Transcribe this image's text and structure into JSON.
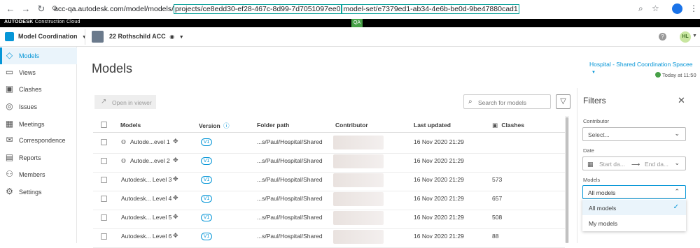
{
  "browser": {
    "url_base": "acc-qa.autodesk.com/model/models/",
    "url_project": "projects/ce8edd30-ef28-467c-8d99-7d7051097ee0",
    "url_modelset": "model-set/e7379ed1-ab34-4e6b-be0d-9be47880cad1"
  },
  "acc_strip": {
    "brand": "AUTODESK",
    "brand_sub": "Construction Cloud",
    "env_badge": "QA"
  },
  "header": {
    "module": "Model Coordination",
    "project": "22 Rothschild ACC",
    "user_initials": "HL",
    "help": "?"
  },
  "sidebar": {
    "items": [
      {
        "label": "Models",
        "icon": "cube-icon"
      },
      {
        "label": "Views",
        "icon": "views-icon"
      },
      {
        "label": "Clashes",
        "icon": "clashes-icon"
      },
      {
        "label": "Issues",
        "icon": "issues-icon"
      },
      {
        "label": "Meetings",
        "icon": "meetings-icon"
      },
      {
        "label": "Correspondence",
        "icon": "mail-icon"
      },
      {
        "label": "Reports",
        "icon": "reports-icon"
      },
      {
        "label": "Members",
        "icon": "members-icon"
      },
      {
        "label": "Settings",
        "icon": "settings-icon"
      }
    ]
  },
  "main": {
    "title": "Models",
    "space": "Hospital - Shared Coordination Spacee",
    "updated": "Today at 11:50",
    "open_in_viewer": "Open in viewer",
    "search_placeholder": "Search for models",
    "columns": {
      "models": "Models",
      "version": "Version",
      "folder": "Folder path",
      "contributor": "Contributor",
      "last_updated": "Last updated",
      "clashes": "Clashes"
    },
    "rows": [
      {
        "model": "Autode...evel 1",
        "version": "V1",
        "folder": "...s/Paul/Hospital/Shared",
        "updated": "16 Nov 2020 21:29",
        "clashes": ""
      },
      {
        "model": "Autode...evel 2",
        "version": "V1",
        "folder": "...s/Paul/Hospital/Shared",
        "updated": "16 Nov 2020 21:29",
        "clashes": ""
      },
      {
        "model": "Autodesk... Level 3",
        "version": "V1",
        "folder": "...s/Paul/Hospital/Shared",
        "updated": "16 Nov 2020 21:29",
        "clashes": "573"
      },
      {
        "model": "Autodesk... Level 4",
        "version": "V1",
        "folder": "...s/Paul/Hospital/Shared",
        "updated": "16 Nov 2020 21:29",
        "clashes": "657"
      },
      {
        "model": "Autodesk... Level 5",
        "version": "V1",
        "folder": "...s/Paul/Hospital/Shared",
        "updated": "16 Nov 2020 21:29",
        "clashes": "508"
      },
      {
        "model": "Autodesk... Level 6",
        "version": "V1",
        "folder": "...s/Paul/Hospital/Shared",
        "updated": "16 Nov 2020 21:29",
        "clashes": "88"
      }
    ]
  },
  "filters": {
    "title": "Filters",
    "contributor_label": "Contributor",
    "contributor_value": "Select...",
    "date_label": "Date",
    "start_placeholder": "Start da...",
    "end_placeholder": "End da...",
    "models_label": "Models",
    "models_value": "All models",
    "options": [
      "All models",
      "My models"
    ]
  },
  "colors": {
    "accent": "#0696d7",
    "success": "#47a047",
    "url_highlight": "#0aa29a"
  }
}
